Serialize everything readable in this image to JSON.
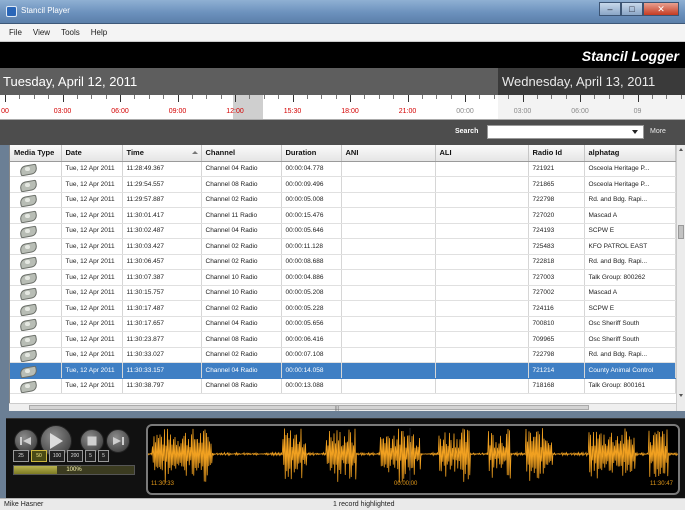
{
  "window": {
    "title": "Stancil Player",
    "min_glyph": "–",
    "max_glyph": "□",
    "close_glyph": "✕"
  },
  "menu": [
    "File",
    "View",
    "Tools",
    "Help"
  ],
  "brand": "Stancil Logger",
  "dates": {
    "left": "Tuesday, April 12, 2011",
    "right": "Wednesday, April 13, 2011"
  },
  "timeline": {
    "labels": [
      {
        "text": "00",
        "color": "red"
      },
      {
        "text": "03:00",
        "color": "red"
      },
      {
        "text": "06:00",
        "color": "red"
      },
      {
        "text": "09:00",
        "color": "red"
      },
      {
        "text": "12:00",
        "color": "red"
      },
      {
        "text": "15:30",
        "color": "red"
      },
      {
        "text": "18:00",
        "color": "red"
      },
      {
        "text": "21:00",
        "color": "red"
      },
      {
        "text": "00:00",
        "color": "gray"
      },
      {
        "text": "03:00",
        "color": "gray"
      },
      {
        "text": "06:00",
        "color": "gray"
      },
      {
        "text": "09",
        "color": "gray"
      }
    ]
  },
  "search": {
    "label": "Search",
    "value": "",
    "more": "More"
  },
  "table": {
    "columns": [
      "Media Type",
      "Date",
      "Time",
      "Channel",
      "Duration",
      "ANI",
      "ALI",
      "Radio Id",
      "alphatag"
    ],
    "rows": [
      {
        "date": "Tue, 12 Apr 2011",
        "time": "11:28:49.367",
        "channel": "Channel 04 Radio",
        "duration": "00:00:04.778",
        "ani": "",
        "ali": "",
        "radio_id": "721921",
        "alphatag": "Osceola Heritage P..."
      },
      {
        "date": "Tue, 12 Apr 2011",
        "time": "11:29:54.557",
        "channel": "Channel 08 Radio",
        "duration": "00:00:09.496",
        "ani": "",
        "ali": "",
        "radio_id": "721865",
        "alphatag": "Osceola Heritage P..."
      },
      {
        "date": "Tue, 12 Apr 2011",
        "time": "11:29:57.887",
        "channel": "Channel 02 Radio",
        "duration": "00:00:05.008",
        "ani": "",
        "ali": "",
        "radio_id": "722798",
        "alphatag": "Rd. and Bdg. Rapi..."
      },
      {
        "date": "Tue, 12 Apr 2011",
        "time": "11:30:01.417",
        "channel": "Channel 11 Radio",
        "duration": "00:00:15.476",
        "ani": "",
        "ali": "",
        "radio_id": "727020",
        "alphatag": "Mascad A"
      },
      {
        "date": "Tue, 12 Apr 2011",
        "time": "11:30:02.487",
        "channel": "Channel 04 Radio",
        "duration": "00:00:05.646",
        "ani": "",
        "ali": "",
        "radio_id": "724193",
        "alphatag": "SCPW E"
      },
      {
        "date": "Tue, 12 Apr 2011",
        "time": "11:30:03.427",
        "channel": "Channel 02 Radio",
        "duration": "00:00:11.128",
        "ani": "",
        "ali": "",
        "radio_id": "725483",
        "alphatag": "KFO PATROL EAST"
      },
      {
        "date": "Tue, 12 Apr 2011",
        "time": "11:30:06.457",
        "channel": "Channel 02 Radio",
        "duration": "00:00:08.688",
        "ani": "",
        "ali": "",
        "radio_id": "722818",
        "alphatag": "Rd. and Bdg. Rapi..."
      },
      {
        "date": "Tue, 12 Apr 2011",
        "time": "11:30:07.387",
        "channel": "Channel 10 Radio",
        "duration": "00:00:04.886",
        "ani": "",
        "ali": "",
        "radio_id": "727003",
        "alphatag": "Talk Group: 800262"
      },
      {
        "date": "Tue, 12 Apr 2011",
        "time": "11:30:15.757",
        "channel": "Channel 10 Radio",
        "duration": "00:00:05.208",
        "ani": "",
        "ali": "",
        "radio_id": "727002",
        "alphatag": "Mascad A"
      },
      {
        "date": "Tue, 12 Apr 2011",
        "time": "11:30:17.487",
        "channel": "Channel 02 Radio",
        "duration": "00:00:05.228",
        "ani": "",
        "ali": "",
        "radio_id": "724116",
        "alphatag": "SCPW E"
      },
      {
        "date": "Tue, 12 Apr 2011",
        "time": "11:30:17.657",
        "channel": "Channel 04 Radio",
        "duration": "00:00:05.656",
        "ani": "",
        "ali": "",
        "radio_id": "700810",
        "alphatag": "Osc Sheriff South"
      },
      {
        "date": "Tue, 12 Apr 2011",
        "time": "11:30:23.877",
        "channel": "Channel 08 Radio",
        "duration": "00:00:06.416",
        "ani": "",
        "ali": "",
        "radio_id": "709965",
        "alphatag": "Osc Sheriff South"
      },
      {
        "date": "Tue, 12 Apr 2011",
        "time": "11:30:33.027",
        "channel": "Channel 02 Radio",
        "duration": "00:00:07.108",
        "ani": "",
        "ali": "",
        "radio_id": "722798",
        "alphatag": "Rd. and Bdg. Rapi..."
      },
      {
        "date": "Tue, 12 Apr 2011",
        "time": "11:30:33.157",
        "channel": "Channel 04 Radio",
        "duration": "00:00:14.058",
        "ani": "",
        "ali": "",
        "radio_id": "721214",
        "alphatag": "County Animal Control",
        "selected": true
      },
      {
        "date": "Tue, 12 Apr 2011",
        "time": "11:30:38.797",
        "channel": "Channel 08 Radio",
        "duration": "00:00:13.088",
        "ani": "",
        "ali": "",
        "radio_id": "718168",
        "alphatag": "Talk Group: 800161"
      }
    ]
  },
  "player": {
    "speeds": [
      "25",
      "50",
      "100",
      "200",
      "5",
      "5"
    ],
    "active_speed_index": 1,
    "zoom_label": "100%",
    "zoom_fraction": 0.36,
    "wave_start": "11:30:33",
    "wave_mid": "00:00:00",
    "wave_end": "11:30:47",
    "wave_color": "#f0a020"
  },
  "status": {
    "user": "Mike Hasner",
    "selection": "1 record highlighted"
  }
}
